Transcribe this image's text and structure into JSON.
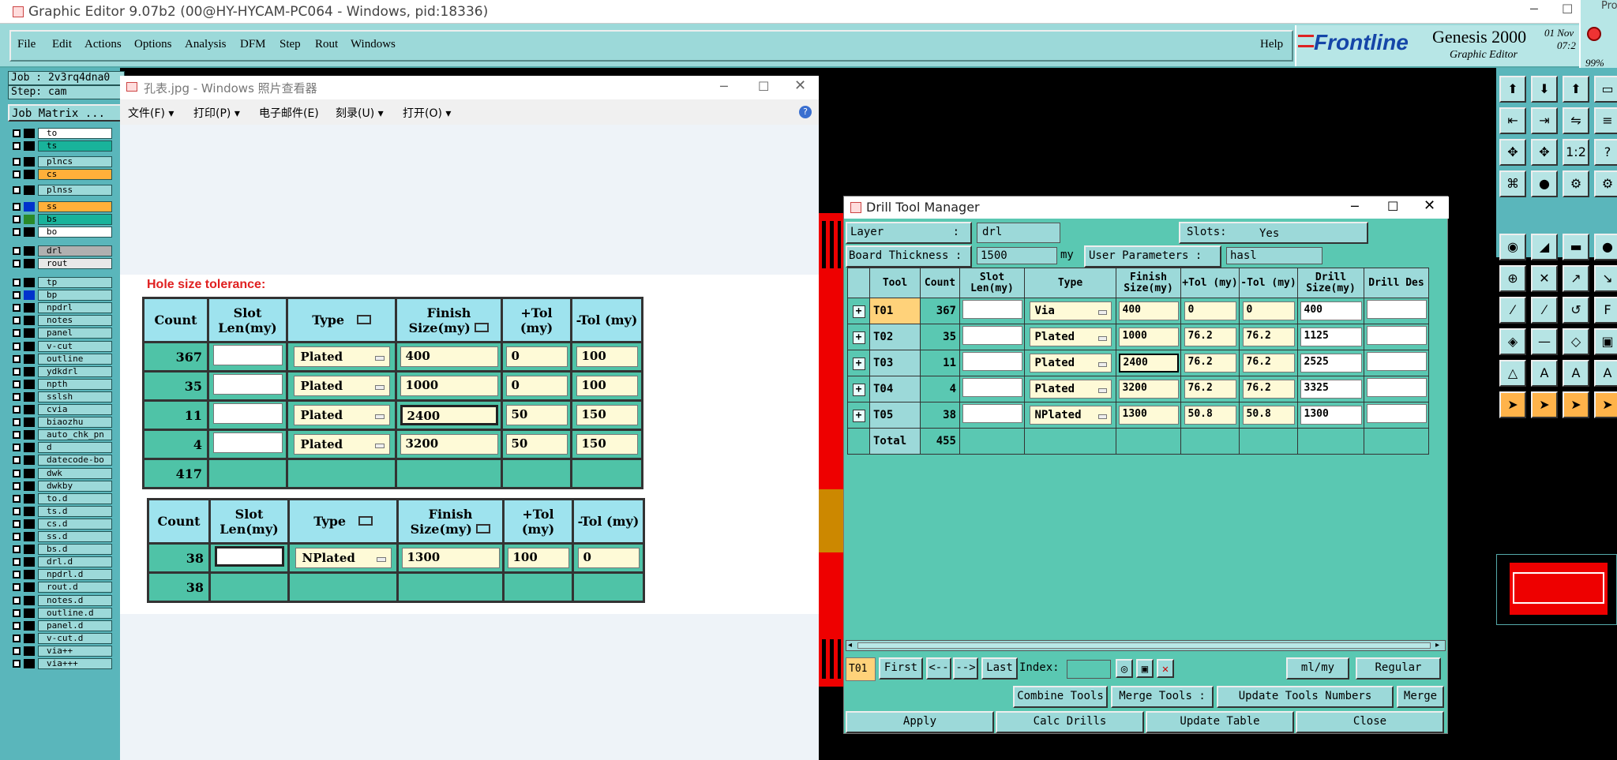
{
  "window": {
    "title": "Graphic Editor 9.07b2 (00@HY-HYCAM-PC064 - Windows, pid:18336)"
  },
  "menu": [
    "File",
    "Edit",
    "Actions",
    "Options",
    "Analysis",
    "DFM",
    "Step",
    "Rout",
    "Windows"
  ],
  "help": "Help",
  "brand": {
    "logo": "Frontline",
    "product": "Genesis 2000",
    "sub": "Graphic Editor",
    "date1": "01 Nov",
    "date2": "07:2",
    "pct": "99%",
    "corner": "Pro"
  },
  "left": {
    "job": "Job : 2v3rq4dna0",
    "step": "Step: cam",
    "matrix": "Job Matrix ...",
    "layers": [
      "to",
      "ts",
      "plncs",
      "cs",
      "plnss",
      "ss",
      "bs",
      "bo",
      "drl",
      "rout",
      "tp",
      "bp",
      "npdrl",
      "notes",
      "panel",
      "v-cut",
      "outline",
      "ydkdrl",
      "npth",
      "sslsh",
      "cvia",
      "biaozhu",
      "auto_chk_pn",
      "d",
      "datecode-bo",
      "dwk",
      "dwkby",
      "to.d",
      "ts.d",
      "cs.d",
      "ss.d",
      "bs.d",
      "drl.d",
      "npdrl.d",
      "rout.d",
      "notes.d",
      "outline.d",
      "panel.d",
      "v-cut.d",
      "via++",
      "via+++"
    ],
    "layer_colors": {
      "ts": "#19b39b",
      "cs": "#ffb03a",
      "ss": "#ffb03a",
      "bs": "#19b39b",
      "bo": "#ffffff",
      "to": "#ffffff",
      "drl": "#b0b0b0",
      "rout": "#e8e8e8"
    }
  },
  "photo": {
    "title": "孔表.jpg - Windows 照片查看器",
    "menu": [
      "文件(F)",
      "打印(P)",
      "电子邮件(E)",
      "刻录(U)",
      "打开(O)"
    ],
    "heading": "Hole size tolerance:",
    "headers": [
      "Count",
      "Slot Len(my)",
      "Type",
      "Finish Size(my)",
      "+Tol (my)",
      "-Tol (my)"
    ],
    "rows": [
      {
        "count": "367",
        "type": "Plated",
        "finish": "400",
        "ptol": "0",
        "mtol": "100"
      },
      {
        "count": "35",
        "type": "Plated",
        "finish": "1000",
        "ptol": "0",
        "mtol": "100"
      },
      {
        "count": "11",
        "type": "Plated",
        "finish": "2400",
        "ptol": "50",
        "mtol": "150"
      },
      {
        "count": "4",
        "type": "Plated",
        "finish": "3200",
        "ptol": "50",
        "mtol": "150"
      }
    ],
    "total1": "417",
    "rows2": [
      {
        "count": "38",
        "type": "NPlated",
        "finish": "1300",
        "ptol": "100",
        "mtol": "0"
      }
    ],
    "total2": "38"
  },
  "dtm": {
    "title": "Drill Tool Manager",
    "layer_label": "Layer",
    "layer_colon": ":",
    "layer_value": "drl",
    "slots_label": "Slots:",
    "slots_value": "Yes",
    "board_label": "Board Thickness :",
    "board_value": "1500",
    "board_unit": "my",
    "user_label": "User Parameters :",
    "user_value": "hasl",
    "headers": [
      "Tool",
      "Count",
      "Slot Len(my)",
      "Type",
      "Finish Size(my)",
      "+Tol (my)",
      "-Tol (my)",
      "Drill Size(my)",
      "Drill Des"
    ],
    "rows": [
      {
        "tool": "T01",
        "count": "367",
        "type": "Via",
        "finish": "400",
        "ptol": "0",
        "mtol": "0",
        "drill": "400"
      },
      {
        "tool": "T02",
        "count": "35",
        "type": "Plated",
        "finish": "1000",
        "ptol": "76.2",
        "mtol": "76.2",
        "drill": "1125"
      },
      {
        "tool": "T03",
        "count": "11",
        "type": "Plated",
        "finish": "2400",
        "ptol": "76.2",
        "mtol": "76.2",
        "drill": "2525"
      },
      {
        "tool": "T04",
        "count": "4",
        "type": "Plated",
        "finish": "3200",
        "ptol": "76.2",
        "mtol": "76.2",
        "drill": "3325"
      },
      {
        "tool": "T05",
        "count": "38",
        "type": "NPlated",
        "finish": "1300",
        "ptol": "50.8",
        "mtol": "50.8",
        "drill": "1300"
      }
    ],
    "total_label": "Total",
    "total_value": "455",
    "current_tool": "T01",
    "nav": [
      "First",
      "<--",
      "-->",
      "Last"
    ],
    "index_label": "Index:",
    "units": "ml/my",
    "mode": "Regular",
    "combine": "Combine Tools",
    "merge_label": "Merge Tools :",
    "merge_option": "Update Tools Numbers",
    "merge": "Merge",
    "buttons": [
      "Apply",
      "Calc Drills",
      "Update Table",
      "Close"
    ]
  }
}
